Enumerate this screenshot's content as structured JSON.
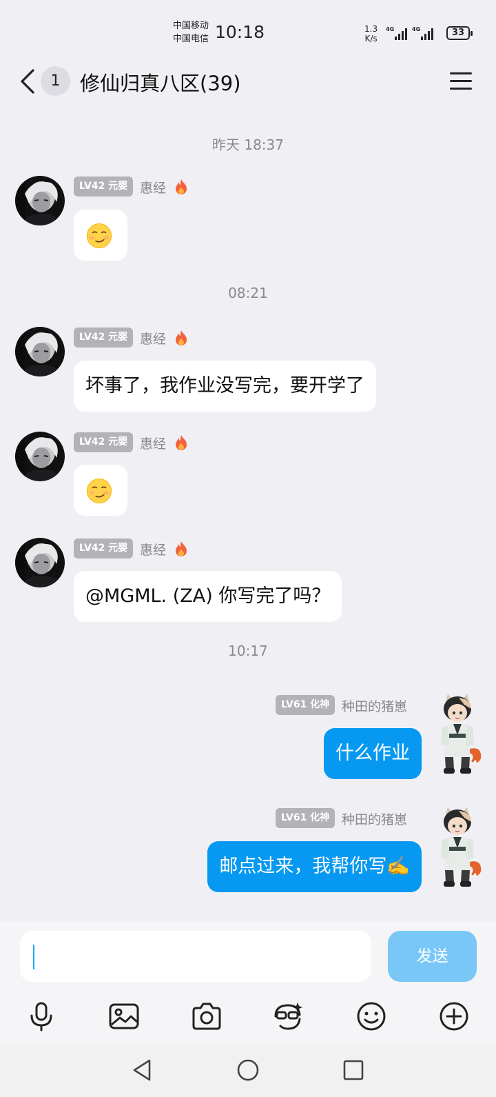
{
  "status_bar": {
    "carrier_1": "中国移动",
    "carrier_2": "中国电信",
    "time": "10:18",
    "net_speed_value": "1.3",
    "net_speed_unit": "K/s",
    "signal_1_type": "4G",
    "signal_2_type": "4G",
    "battery": "33"
  },
  "header": {
    "unread_count": "1",
    "title": "修仙归真八区(39)",
    "icons": [
      "back-arrow-icon",
      "menu-icon"
    ]
  },
  "messages": {
    "timestamps": [
      "昨天 18:37",
      "08:21",
      "10:17"
    ],
    "m1": {
      "level": "LV42 元婴",
      "sender": "惠经",
      "content_icon": "smirk-emoji"
    },
    "m2": {
      "level": "LV42 元婴",
      "sender": "惠经",
      "text": "坏事了，我作业没写完，要开学了"
    },
    "m3": {
      "level": "LV42 元婴",
      "sender": "惠经",
      "content_icon": "smirk-emoji"
    },
    "m4": {
      "level": "LV42 元婴",
      "sender": "惠经",
      "text": "@MGML. (ZA) 你写完了吗？"
    },
    "m5": {
      "level": "LV61 化神",
      "sender": "种田的猪崽",
      "text": "什么作业"
    },
    "m6": {
      "level": "LV61 化神",
      "sender": "种田的猪崽",
      "text": "邮点过来，我帮你写✍️"
    }
  },
  "input_bar": {
    "input_value": "",
    "send_label": "发送"
  },
  "toolbar_icons": [
    "microphone-icon",
    "image-icon",
    "camera-icon",
    "sticker-icon",
    "emoji-icon",
    "plus-icon"
  ],
  "navigation_icons": [
    "back-triangle-icon",
    "home-circle-icon",
    "recents-square-icon"
  ],
  "colors": {
    "background": "#f0f0f4",
    "outgoing_bubble": "#0799f2",
    "send_button": "#79c7f7",
    "level_badge": "#b2b2b8"
  }
}
